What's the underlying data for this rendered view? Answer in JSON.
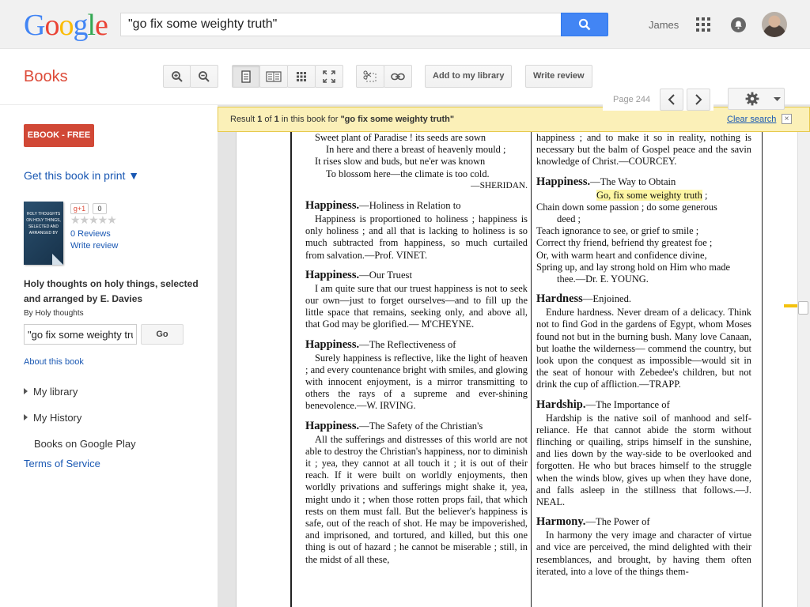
{
  "header": {
    "logo_letters": [
      {
        "ch": "G",
        "color": "#4285f4"
      },
      {
        "ch": "o",
        "color": "#ea4335"
      },
      {
        "ch": "o",
        "color": "#fbbc05"
      },
      {
        "ch": "g",
        "color": "#4285f4"
      },
      {
        "ch": "l",
        "color": "#34a853"
      },
      {
        "ch": "e",
        "color": "#ea4335"
      }
    ],
    "search_value": "\"go fix some weighty truth\"",
    "user_name": "James"
  },
  "toolbar": {
    "section_title": "Books",
    "add_library_label": "Add to my library",
    "write_review_label": "Write review",
    "page_label": "Page 244"
  },
  "sidebar": {
    "ebook_label": "EBOOK - FREE",
    "get_book_label": "Get this book in print ▼",
    "cover_text": "HOLY THOUGHTS ON HOLY THINGS, SELECTED AND ARRANGED BY",
    "gplus_label": "g+1",
    "gplus_count": "0",
    "stars": "★★★★★",
    "reviews_label": "0 Reviews",
    "write_review_label": "Write review",
    "book_title": "Holy thoughts on holy things, selected and arranged by E. Davies",
    "by_author": "By Holy thoughts",
    "search_value": "\"go fix some weighty truth\"",
    "go_label": "Go",
    "about_label": "About this book",
    "nav": {
      "my_library": "My library",
      "my_history": "My History",
      "google_play": "Books on Google Play"
    },
    "tos_label": "Terms of Service"
  },
  "result_bar": {
    "prefix": "Result ",
    "num": "1",
    "of": " of ",
    "total": "1",
    "middle": " in this book for ",
    "query": "\"go fix some weighty truth\"",
    "clear_label": "Clear search",
    "close_label": "×"
  },
  "scan": {
    "left": {
      "verse1": [
        "Sweet plant of Paradise ! its seeds are sown",
        "In here and there a breast of heavenly mould ;",
        "It rises slow and buds, but ne'er was known",
        "To blossom here—the climate is too cold."
      ],
      "verse1_sig": "—SHERIDAN.",
      "h1": "Happiness.",
      "h1_sub": "—Holiness in Relation to",
      "p1": "Happiness is proportioned to holiness ; happiness is only holiness ; and all that is lacking to holiness is so much subtracted from happiness, so much curtailed from salvation.—Prof. VINET.",
      "h2": "Happiness.",
      "h2_sub": "—Our Truest",
      "p2": "I am quite sure that our truest happiness is not to seek our own—just to forget ourselves—and to fill up the little space that remains, seeking only, and above all, that God may be glorified.— M'CHEYNE.",
      "h3": "Happiness.",
      "h3_sub": "—The Reflectiveness of",
      "p3": "Surely happiness is reflective, like the light of heaven ; and every countenance bright with smiles, and glowing with innocent enjoyment, is a mirror transmitting to others the rays of a supreme and ever-shining benevolence.—W. IRVING.",
      "h4": "Happiness.",
      "h4_sub": "—The Safety of the Christian's",
      "p4": "All the sufferings and distresses of this world are not able to destroy the Christian's happiness, nor to diminish it ; yea, they cannot at all touch it ; it is out of their reach. If it were built on worldly enjoyments, then worldly privations and sufferings might shake it, yea, might undo it ; when those rotten props fail, that which rests on them must fall. But the believer's happiness is safe, out of the reach of shot. He may be impoverished, and imprisoned, and tortured, and killed, but this one thing is out of hazard ; he cannot be miserable ; still, in the midst of all these,"
    },
    "right": {
      "p0": "happiness ; and to make it so in reality, nothing is necessary but the balm of Gospel peace and the savin knowledge of Christ.—COURCEY.",
      "h1": "Happiness.",
      "h1_sub": "—The Way to Obtain",
      "v_highlight": "Go, fix some weighty truth",
      "v_after": " ;",
      "verse": [
        "Chain down some passion ; do some generous",
        "deed ;",
        "Teach ignorance to see, or grief to smile ;",
        "Correct thy friend, befriend thy greatest foe ;",
        "Or, with warm heart and confidence divine,",
        "Spring up, and lay strong hold on Him who made",
        "thee.—Dr. E. YOUNG."
      ],
      "h2": "Hardness",
      "h2_sub": "—Enjoined.",
      "p2": "Endure hardness. Never dream of a delicacy. Think not to find God in the gardens of Egypt, whom Moses found not but in the burning bush. Many love Canaan, but loathe the wilderness— commend the country, but look upon the conquest as impossible—would sit in the seat of honour with Zebedee's children, but not drink the cup of affliction.—TRAPP.",
      "h3": "Hardship.",
      "h3_sub": "—The Importance of",
      "p3": "Hardship is the native soil of manhood and self-reliance. He that cannot abide the storm without flinching or quailing, strips himself in the sunshine, and lies down by the way-side to be overlooked and forgotten. He who but braces himself to the struggle when the winds blow, gives up when they have done, and falls asleep in the stillness that follows.—J. NEAL.",
      "h4": "Harmony.",
      "h4_sub": "—The Power of",
      "p4": "In harmony the very image and character of virtue and vice are perceived, the mind delighted with their resemblances, and brought, by having them often iterated, into a love of the things them-"
    }
  },
  "colors": {
    "accent_red": "#dd4b39",
    "ebook_red": "#d14836",
    "search_blue": "#4285f4",
    "link_blue": "#1a58b3",
    "result_bar_bg": "#fbf0b8",
    "highlight": "#fdf6a3"
  },
  "icons": [
    "search-icon",
    "apps-grid-icon",
    "notifications-icon",
    "zoom-in-icon",
    "zoom-out-icon",
    "single-page-icon",
    "two-page-icon",
    "thumbnail-grid-icon",
    "fullscreen-icon",
    "clip-icon",
    "link-icon",
    "chevron-left-icon",
    "chevron-right-icon",
    "gear-icon",
    "close-icon"
  ]
}
